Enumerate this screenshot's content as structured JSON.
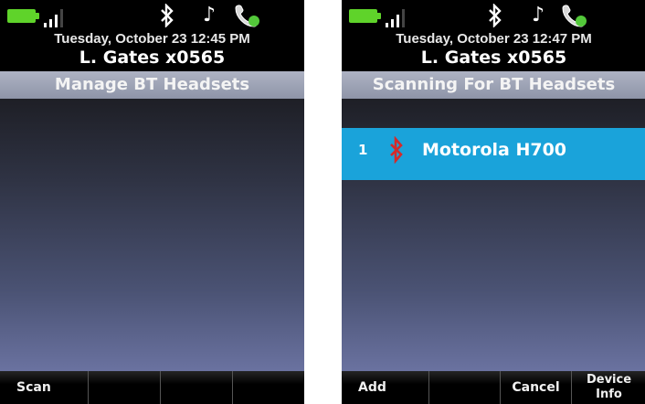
{
  "left_screen": {
    "status": {
      "battery_icon": "battery-icon",
      "signal_icon": "signal-bars-icon",
      "bluetooth_icon": "bluetooth-icon",
      "note_icon": "music-note-icon",
      "handset_icon": "handset-icon"
    },
    "date": "Tuesday, October 23 12:45 PM",
    "user": "L. Gates x0565",
    "title": "Manage BT Headsets",
    "softkeys": [
      "Scan",
      "",
      "",
      ""
    ]
  },
  "right_screen": {
    "status": {
      "battery_icon": "battery-icon",
      "signal_icon": "signal-bars-icon",
      "bluetooth_icon": "bluetooth-icon",
      "note_icon": "music-note-icon",
      "handset_icon": "handset-icon"
    },
    "date": "Tuesday, October 23 12:47 PM",
    "user": "L. Gates x0565",
    "title": "Scanning For BT Headsets",
    "devices": [
      {
        "index": "1",
        "name": "Motorola H700",
        "icon": "bluetooth-icon"
      }
    ],
    "softkeys": [
      "Add",
      "",
      "Cancel",
      "Device Info"
    ]
  },
  "colors": {
    "battery": "#5fd32a",
    "highlight": "#1aa3da",
    "bt_red": "#d42a2a",
    "title_bar": "#9ea3b6"
  }
}
